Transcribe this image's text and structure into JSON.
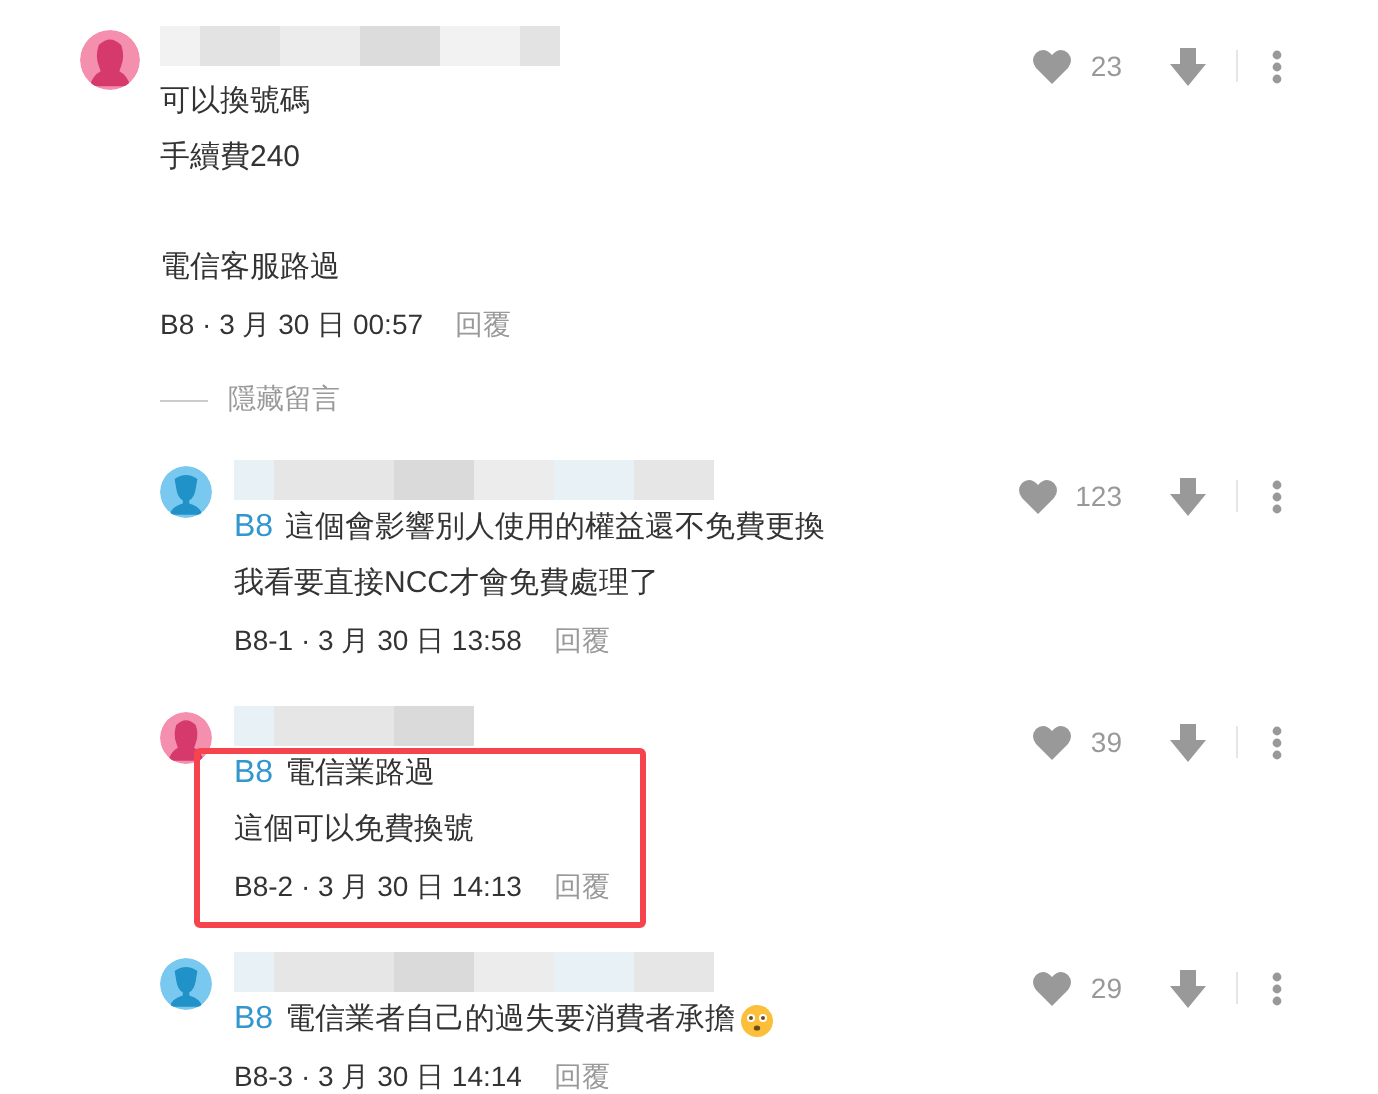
{
  "comments": [
    {
      "color": "#f58fae",
      "likes": "23",
      "paragraphs": [
        [
          "可以換號碼",
          "手續費240"
        ],
        [
          "電信客服路過"
        ]
      ],
      "meta": "B8 · 3 月 30 日 00:57",
      "reply_label": "回覆",
      "hide_replies": "隱藏留言",
      "replies": [
        {
          "color": "#79c8f0",
          "likes": "123",
          "mention": "B8",
          "lines": [
            "這個會影響別人使用的權益還不免費更換",
            "我看要直接NCC才會免費處理了"
          ],
          "meta": "B8-1 · 3 月 30 日 13:58",
          "reply_label": "回覆",
          "highlighted": false
        },
        {
          "color": "#f58fae",
          "likes": "39",
          "mention": "B8",
          "lines": [
            "電信業路過",
            "這個可以免費換號"
          ],
          "meta": "B8-2 · 3 月 30 日 14:13",
          "reply_label": "回覆",
          "highlighted": true
        },
        {
          "color": "#79c8f0",
          "likes": "29",
          "mention": "B8",
          "lines": [
            "電信業者自己的過失要消費者承擔"
          ],
          "meta": "B8-3 · 3 月 30 日 14:14",
          "reply_label": "回覆",
          "highlighted": false,
          "emoji": true
        }
      ]
    }
  ]
}
